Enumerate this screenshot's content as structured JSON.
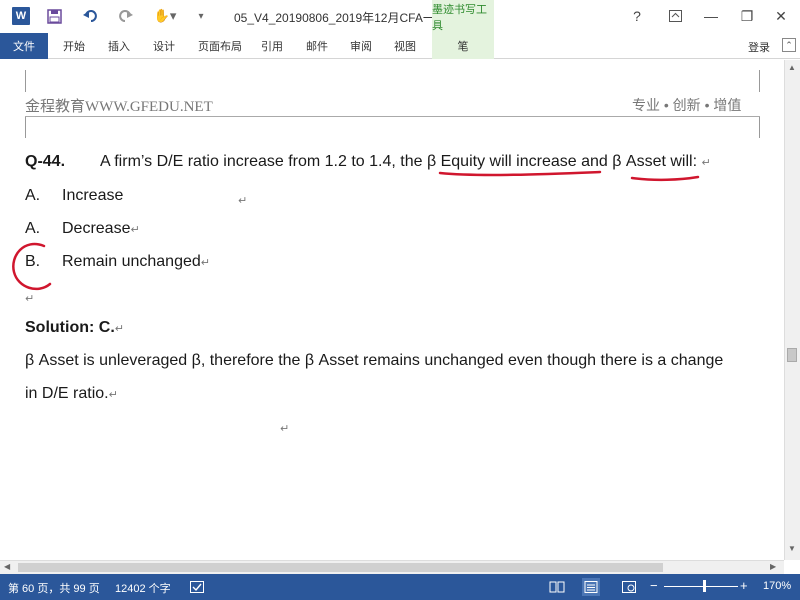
{
  "titlebar": {
    "app_icon": "W",
    "doc_title": "05_V4_20190806_2019年12月CFA一级百题...",
    "context_tool": "墨迹书写工具",
    "help": "?",
    "minimize": "—",
    "restore": "❐",
    "close": "✕"
  },
  "ribbon": {
    "tabs": [
      "文件",
      "开始",
      "插入",
      "设计",
      "页面布局",
      "引用",
      "邮件",
      "审阅",
      "视图",
      "笔"
    ],
    "login": "登录"
  },
  "document": {
    "header_left": "金程教育WWW.GFEDU.NET",
    "header_right": "专业 • 创新 • 增值",
    "question_number": "Q-44.",
    "question_text": "A firm’s D/E ratio increase from 1.2 to 1.4, the β Equity will increase and β Asset will:",
    "options": [
      {
        "letter": "A.",
        "text": "Increase"
      },
      {
        "letter": "A.",
        "text": "Decrease"
      },
      {
        "letter": "B.",
        "text": "Remain unchanged"
      }
    ],
    "solution": "Solution: C.",
    "explanation_line1": "β Asset is unleveraged β, therefore the β Asset remains unchanged even though there is a change",
    "explanation_line2": "in D/E ratio.",
    "paragraph_mark": "↵"
  },
  "ink_color": "#d0162e",
  "statusbar": {
    "page": "第 60 页，共 99 页",
    "words": "12402 个字",
    "zoom": "170%",
    "zoom_minus": "−",
    "zoom_plus": "+"
  }
}
